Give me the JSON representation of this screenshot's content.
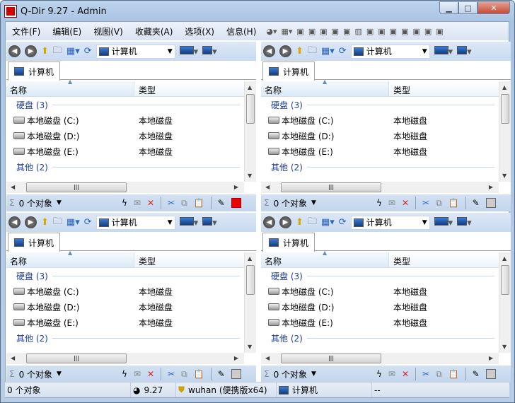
{
  "window": {
    "title": "Q-Dir 9.27 - Admin"
  },
  "menu": [
    "文件(F)",
    "编辑(E)",
    "视图(V)",
    "收藏夹(A)",
    "选项(X)",
    "信息(H)"
  ],
  "panes": [
    {
      "address": "计算机",
      "tab": "计算机",
      "col_name": "名称",
      "col_type": "类型",
      "groups": [
        {
          "label": "硬盘 (3)"
        },
        {
          "label": "其他 (2)"
        }
      ],
      "drives": [
        {
          "name": "本地磁盘 (C:)",
          "type": "本地磁盘"
        },
        {
          "name": "本地磁盘 (D:)",
          "type": "本地磁盘"
        },
        {
          "name": "本地磁盘 (E:)",
          "type": "本地磁盘"
        }
      ],
      "status": "0 个对象",
      "active": true
    },
    {
      "address": "计算机",
      "tab": "计算机",
      "col_name": "名称",
      "col_type": "类型",
      "groups": [
        {
          "label": "硬盘 (3)"
        },
        {
          "label": "其他 (2)"
        }
      ],
      "drives": [
        {
          "name": "本地磁盘 (C:)",
          "type": "本地磁盘"
        },
        {
          "name": "本地磁盘 (D:)",
          "type": "本地磁盘"
        },
        {
          "name": "本地磁盘 (E:)",
          "type": "本地磁盘"
        }
      ],
      "status": "0 个对象",
      "active": false
    },
    {
      "address": "计算机",
      "tab": "计算机",
      "col_name": "名称",
      "col_type": "类型",
      "groups": [
        {
          "label": "硬盘 (3)"
        },
        {
          "label": "其他 (2)"
        }
      ],
      "drives": [
        {
          "name": "本地磁盘 (C:)",
          "type": "本地磁盘"
        },
        {
          "name": "本地磁盘 (D:)",
          "type": "本地磁盘"
        },
        {
          "name": "本地磁盘 (E:)",
          "type": "本地磁盘"
        }
      ],
      "status": "0 个对象",
      "active": false
    },
    {
      "address": "计算机",
      "tab": "计算机",
      "col_name": "名称",
      "col_type": "类型",
      "groups": [
        {
          "label": "硬盘 (3)"
        },
        {
          "label": "其他 (2)"
        }
      ],
      "drives": [
        {
          "name": "本地磁盘 (C:)",
          "type": "本地磁盘"
        },
        {
          "name": "本地磁盘 (D:)",
          "type": "本地磁盘"
        },
        {
          "name": "本地磁盘 (E:)",
          "type": "本地磁盘"
        }
      ],
      "status": "0 个对象",
      "active": false
    }
  ],
  "statusbar": {
    "objects": "0 个对象",
    "version": "9.27",
    "user": "wuhan (便携版x64)",
    "location": "计算机",
    "extra": "--"
  }
}
